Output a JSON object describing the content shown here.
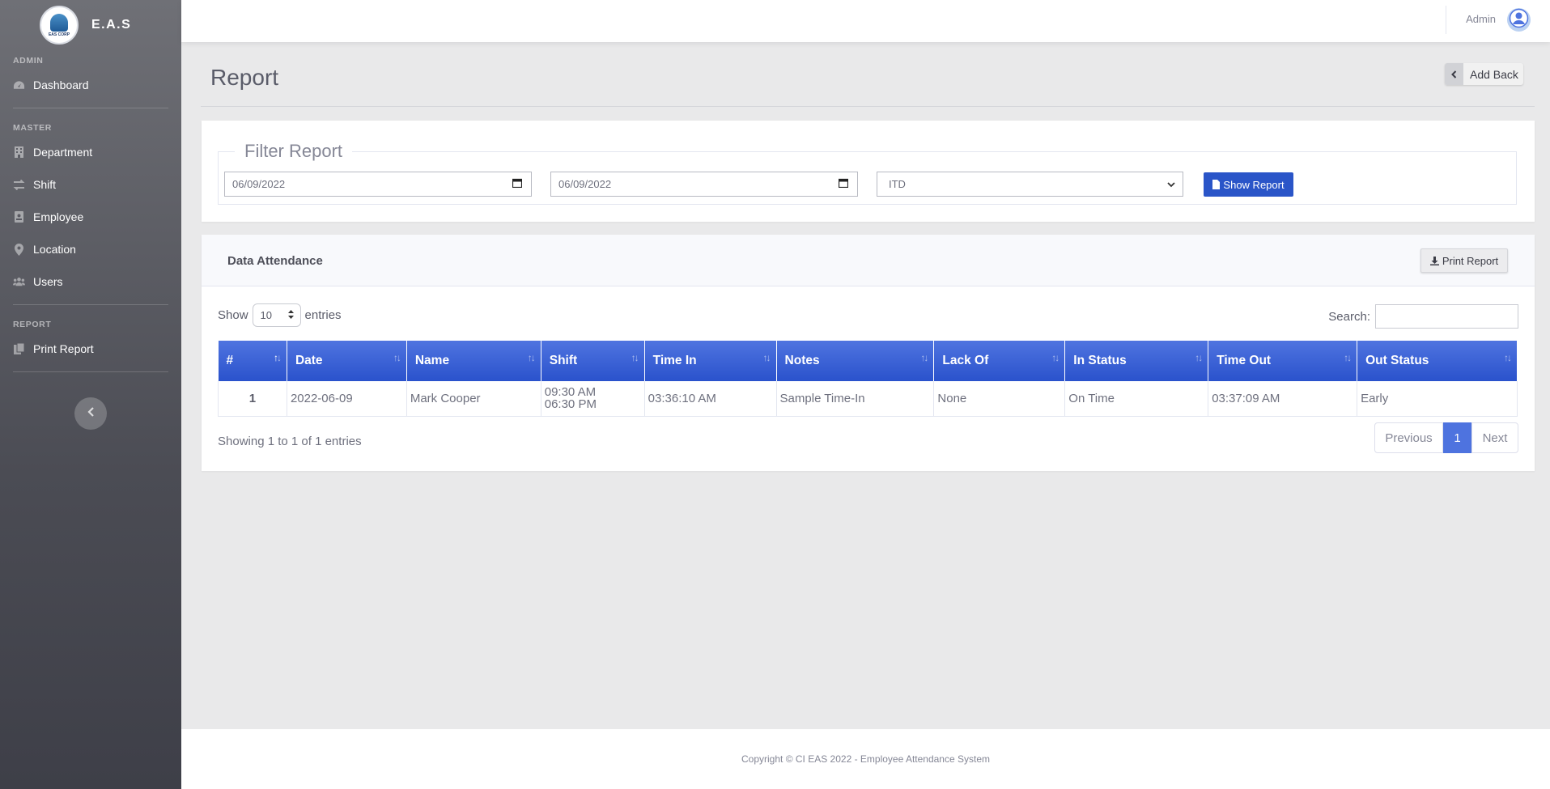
{
  "brand": {
    "name": "E.A.S",
    "logo_caption": "EAS CORP"
  },
  "sidebar": {
    "heading_admin": "ADMIN",
    "heading_master": "MASTER",
    "heading_report": "REPORT",
    "items": [
      {
        "label": "Dashboard",
        "icon": "tachometer-icon"
      },
      {
        "label": "Department",
        "icon": "building-icon"
      },
      {
        "label": "Shift",
        "icon": "exchange-icon"
      },
      {
        "label": "Employee",
        "icon": "id-badge-icon"
      },
      {
        "label": "Location",
        "icon": "map-marker-icon"
      },
      {
        "label": "Users",
        "icon": "users-icon"
      },
      {
        "label": "Print Report",
        "icon": "copy-icon"
      }
    ]
  },
  "topbar": {
    "user_name": "Admin"
  },
  "page": {
    "title": "Report",
    "back_label": "Add Back"
  },
  "filter": {
    "legend": "Filter Report",
    "date_from": "06/09/2022",
    "date_to": "06/09/2022",
    "department": "ITD",
    "show_label": "Show Report"
  },
  "attendance": {
    "title": "Data Attendance",
    "print_label": "Print Report",
    "show_label": "Show",
    "length_value": "10",
    "entries_label": "entries",
    "search_label": "Search:",
    "columns": [
      "#",
      "Date",
      "Name",
      "Shift",
      "Time In",
      "Notes",
      "Lack Of",
      "In Status",
      "Time Out",
      "Out Status"
    ],
    "rows": [
      {
        "num": "1",
        "date": "2022-06-09",
        "name": "Mark Cooper",
        "shift_start": "09:30 AM",
        "shift_end": "06:30 PM",
        "time_in": "03:36:10 AM",
        "notes": "Sample Time-In",
        "lack_of": "None",
        "in_status": "On Time",
        "time_out": "03:37:09 AM",
        "out_status": "Early"
      }
    ],
    "info": "Showing 1 to 1 of 1 entries",
    "pager": {
      "prev": "Previous",
      "current": "1",
      "next": "Next"
    }
  },
  "footer": {
    "text": "Copyright © CI EAS 2022 - Employee Attendance System"
  },
  "colors": {
    "primary": "#4e73df",
    "header_blue": "#2a52cc",
    "sidebar_top": "#6f7076",
    "sidebar_bottom": "#3e3f48"
  }
}
